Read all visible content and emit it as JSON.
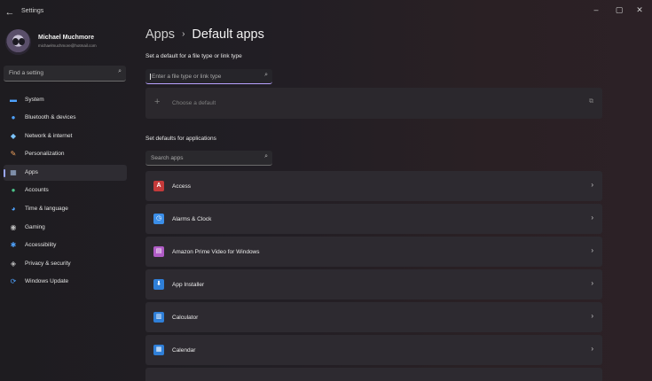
{
  "window": {
    "title": "Settings",
    "back_glyph": "←",
    "minimize_glyph": "–",
    "maximize_glyph": "▢",
    "close_glyph": "✕"
  },
  "user": {
    "name": "Michael Muchmore",
    "email": "michaelmuchmore@hotmail.com"
  },
  "search": {
    "placeholder": "Find a setting",
    "icon": "search-icon",
    "glyph": "⌕"
  },
  "sidebar": {
    "items": [
      {
        "label": "System",
        "icon": "monitor-icon",
        "glyph": "▬",
        "color": "#4fa3ff"
      },
      {
        "label": "Bluetooth & devices",
        "icon": "bluetooth-icon",
        "glyph": "●",
        "color": "#4fa3ff"
      },
      {
        "label": "Network & internet",
        "icon": "wifi-icon",
        "glyph": "◆",
        "color": "#7cc4ff"
      },
      {
        "label": "Personalization",
        "icon": "brush-icon",
        "glyph": "✎",
        "color": "#f0a35e"
      },
      {
        "label": "Apps",
        "icon": "apps-icon",
        "glyph": "▦",
        "color": "#9db4d6"
      },
      {
        "label": "Accounts",
        "icon": "person-icon",
        "glyph": "●",
        "color": "#4cc38a"
      },
      {
        "label": "Time & language",
        "icon": "globe-clock-icon",
        "glyph": "◕",
        "color": "#4fa3ff"
      },
      {
        "label": "Gaming",
        "icon": "controller-icon",
        "glyph": "◉",
        "color": "#bdbdbd"
      },
      {
        "label": "Accessibility",
        "icon": "accessibility-icon",
        "glyph": "✱",
        "color": "#4fa3ff"
      },
      {
        "label": "Privacy & security",
        "icon": "shield-icon",
        "glyph": "◈",
        "color": "#bdbdbd"
      },
      {
        "label": "Windows Update",
        "icon": "update-icon",
        "glyph": "⟳",
        "color": "#4fa3ff"
      }
    ],
    "active_index": 4
  },
  "main": {
    "breadcrumb_root": "Apps",
    "breadcrumb_sep": "›",
    "breadcrumb_current": "Default apps",
    "filetype_label": "Set a default for a file type or link type",
    "filetype_placeholder": "Enter a file type or link type",
    "choose_default_label": "Choose a default",
    "choose_plus_glyph": "+",
    "choose_ext_glyph": "⧉",
    "apps_label": "Set defaults for applications",
    "apps_search_placeholder": "Search apps",
    "chevron_glyph": "›",
    "apps": [
      {
        "name": "Access",
        "icon": "access-icon",
        "glyph": "A",
        "color": "#c43a3a"
      },
      {
        "name": "Alarms & Clock",
        "icon": "alarm-clock-icon",
        "glyph": "◷",
        "color": "#3b8ee8"
      },
      {
        "name": "Amazon Prime Video for Windows",
        "icon": "prime-video-icon",
        "glyph": "▤",
        "color": "#b05cc6"
      },
      {
        "name": "App Installer",
        "icon": "app-installer-icon",
        "glyph": "⬇",
        "color": "#2f7fd8"
      },
      {
        "name": "Calculator",
        "icon": "calculator-icon",
        "glyph": "▥",
        "color": "#2f7fd8"
      },
      {
        "name": "Calendar",
        "icon": "calendar-icon",
        "glyph": "▦",
        "color": "#2f7fd8"
      }
    ]
  }
}
